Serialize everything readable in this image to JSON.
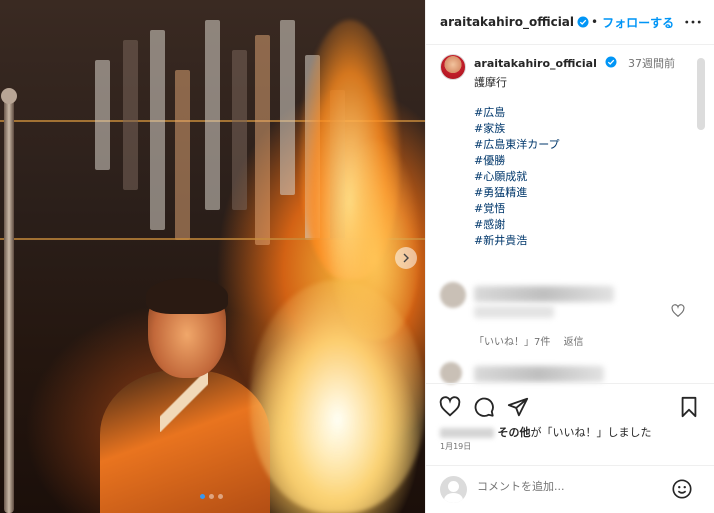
{
  "post": {
    "username": "araitakahiro_official",
    "follow_label": "フォローする",
    "follow_separator": "•",
    "time_ago": "37週間前",
    "caption": "護摩行",
    "hashtags": [
      "#広島",
      "#家族",
      "#広島東洋カープ",
      "#優勝",
      "#心願成就",
      "#勇猛精進",
      "#覚悟",
      "#感謝",
      "#新井貴浩"
    ],
    "comment_likes": "「いいね！」7件",
    "comment_reply": "返信",
    "likes_suffix_bold": "その他",
    "likes_suffix": "が「いいね！」しました",
    "date": "1月19日",
    "comment_placeholder": "コメントを追加...",
    "carousel": {
      "count": 3,
      "active_index": 0
    }
  },
  "colors": {
    "link": "#0095f6",
    "hashtag": "#00376b",
    "carousel_active": "#3797f0",
    "text": "#262626",
    "muted": "#737373"
  },
  "icons": {
    "verified": "verified-badge-icon",
    "more": "more-horizontal-icon",
    "like": "heart-icon",
    "comment": "comment-bubble-icon",
    "share": "paper-plane-icon",
    "save": "bookmark-icon",
    "emoji": "emoji-smile-icon",
    "next": "chevron-right-icon"
  }
}
